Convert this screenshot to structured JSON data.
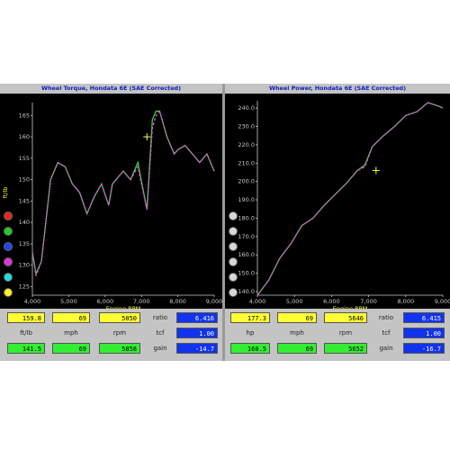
{
  "colors": {
    "plot_bg": "#000000",
    "torque_trace": "#ee44ee",
    "green_trace": "#33dd33",
    "axis": "#c8c8c8",
    "cursor": "#ffff44",
    "title_text": "#1020c0"
  },
  "left": {
    "title": "Wheel Torque, Hondata 6E (SAE Corrected)",
    "y_label": "ft/lb",
    "x_label": "Engine RPM",
    "y_ticks": [
      "165",
      "160",
      "155",
      "150",
      "145",
      "140",
      "135",
      "130",
      "125"
    ],
    "x_ticks": [
      "4,000",
      "5,000",
      "6,000",
      "7,000",
      "8,000",
      "9,000"
    ],
    "series_dots": [
      {
        "color": "#ee2222"
      },
      {
        "color": "#22cc22"
      },
      {
        "color": "#2244ee"
      },
      {
        "color": "#dd33dd"
      },
      {
        "color": "#22dddd"
      },
      {
        "color": "#ffee22"
      }
    ],
    "row1": {
      "value": "159.8",
      "col2": "69",
      "col3": "5050",
      "ratio_label": "ratio",
      "ratio": "6.416"
    },
    "row2": {
      "l1": "ft/lb",
      "l2": "mph",
      "l3": "rpm",
      "tcf_label": "tcf",
      "tcf": "1.00"
    },
    "row3": {
      "value": "141.5",
      "col2": "69",
      "col3": "5858",
      "gain_label": "gain",
      "gain": "-14.7"
    }
  },
  "right": {
    "title": "Wheel Power, Hondata 6E (SAE Corrected)",
    "y_ticks": [
      "240.0",
      "230.0",
      "220.0",
      "210.0",
      "200.0",
      "190.0",
      "180.0",
      "170.0",
      "160.0",
      "150.0",
      "140.0"
    ],
    "x_label": "Engine RPM",
    "x_ticks": [
      "4,000",
      "5,000",
      "6,000",
      "7,000",
      "8,000",
      "9,000"
    ],
    "row1": {
      "value": "177.3",
      "col2": "69",
      "col3": "5646",
      "ratio_label": "ratio",
      "ratio": "6.415"
    },
    "row2": {
      "l1": "hp",
      "l2": "mph",
      "l3": "rpm",
      "tcf_label": "tcf",
      "tcf": "1.00"
    },
    "row3": {
      "value": "160.5",
      "col2": "69",
      "col3": "5652",
      "gain_label": "gain",
      "gain": "-16.7"
    }
  },
  "chart_data": [
    {
      "type": "line",
      "title": "Wheel Torque, Hondata 6E (SAE Corrected)",
      "xlabel": "Engine RPM",
      "ylabel": "ft/lb",
      "xlim": [
        4000,
        9000
      ],
      "ylim": [
        123,
        168
      ],
      "series": [
        {
          "x": [
            4000,
            4100,
            4250,
            4500,
            4700,
            4900,
            5100,
            5300,
            5500,
            5700,
            5900,
            6100,
            6200,
            6500,
            6700,
            6900,
            7150,
            7300,
            7400,
            7500,
            7700,
            7900,
            8000,
            8200,
            8400,
            8600,
            8800,
            9000
          ],
          "values": [
            133,
            128,
            131,
            150,
            154,
            153,
            149,
            147,
            142,
            146,
            149,
            144,
            149,
            152,
            150,
            154,
            143,
            164,
            166,
            166,
            160,
            156,
            157,
            158,
            156,
            154,
            156,
            152
          ]
        },
        {
          "x": [
            4000,
            4100,
            4250,
            4500,
            4700,
            4900,
            5100,
            5300,
            5500,
            5700,
            5900,
            6100,
            6200,
            6500,
            6700,
            6900,
            7150,
            7300,
            7400,
            7500,
            7700,
            7900,
            8000,
            8200,
            8400,
            8600,
            8800,
            9000
          ],
          "values": [
            133,
            127.5,
            131,
            150,
            154,
            153,
            149,
            147,
            142,
            146,
            149,
            144,
            149,
            152,
            150,
            153,
            143,
            162,
            165,
            166,
            160,
            156,
            157,
            158,
            156,
            154,
            156,
            152
          ]
        }
      ]
    },
    {
      "type": "line",
      "title": "Wheel Power, Hondata 6E (SAE Corrected)",
      "xlabel": "Engine RPM",
      "xlim": [
        4000,
        9000
      ],
      "ylim": [
        138,
        244
      ],
      "series": [
        {
          "x": [
            4000,
            4300,
            4600,
            4900,
            5200,
            5500,
            5800,
            6100,
            6400,
            6700,
            6900,
            7100,
            7400,
            7700,
            8000,
            8300,
            8600,
            8900,
            9000
          ],
          "values": [
            138,
            146,
            158,
            166,
            176,
            180,
            187,
            193,
            199,
            206,
            209,
            219,
            225,
            230,
            236,
            238,
            243,
            241,
            240
          ]
        },
        {
          "x": [
            4000,
            4300,
            4600,
            4900,
            5200,
            5500,
            5800,
            6100,
            6400,
            6700,
            6900,
            7100,
            7400,
            7700,
            8000,
            8300,
            8600,
            8900,
            9000
          ],
          "values": [
            138,
            146,
            158,
            166,
            176,
            180,
            187,
            193,
            199,
            206,
            208,
            219,
            225,
            230,
            236,
            238,
            243,
            241,
            240
          ]
        }
      ]
    }
  ]
}
